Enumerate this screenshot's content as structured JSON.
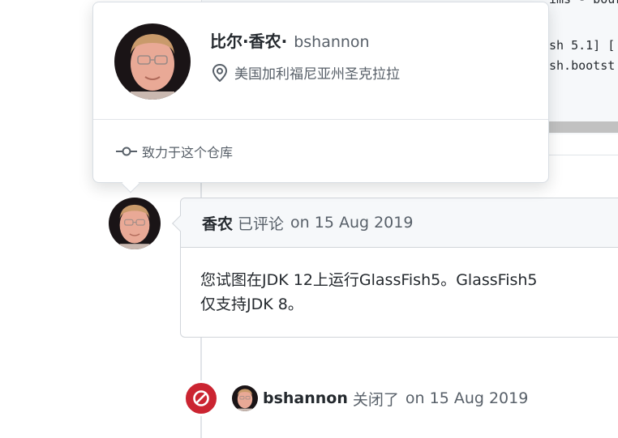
{
  "code": {
    "lines": [
      "ims - bour",
      "sh 5.1] [",
      "sh.bootst"
    ]
  },
  "hovercard": {
    "display_name": "比尔·香农·",
    "login": "bshannon",
    "location": "美国加利福尼亚州圣克拉拉",
    "contribution": "致力于这个仓库"
  },
  "comment": {
    "author": "香农",
    "action": "已评论",
    "date": "on 15 Aug 2019",
    "body_lines": [
      "您试图在JDK 12上运行GlassFish5。GlassFish5",
      "仅支持JDK 8。"
    ]
  },
  "closed_event": {
    "login": "bshannon",
    "action": "关闭了",
    "date": "on 15 Aug 2019"
  },
  "colors": {
    "closed_red": "#cb2431",
    "muted_text": "#586069",
    "header_bg": "#f6f8fa"
  }
}
